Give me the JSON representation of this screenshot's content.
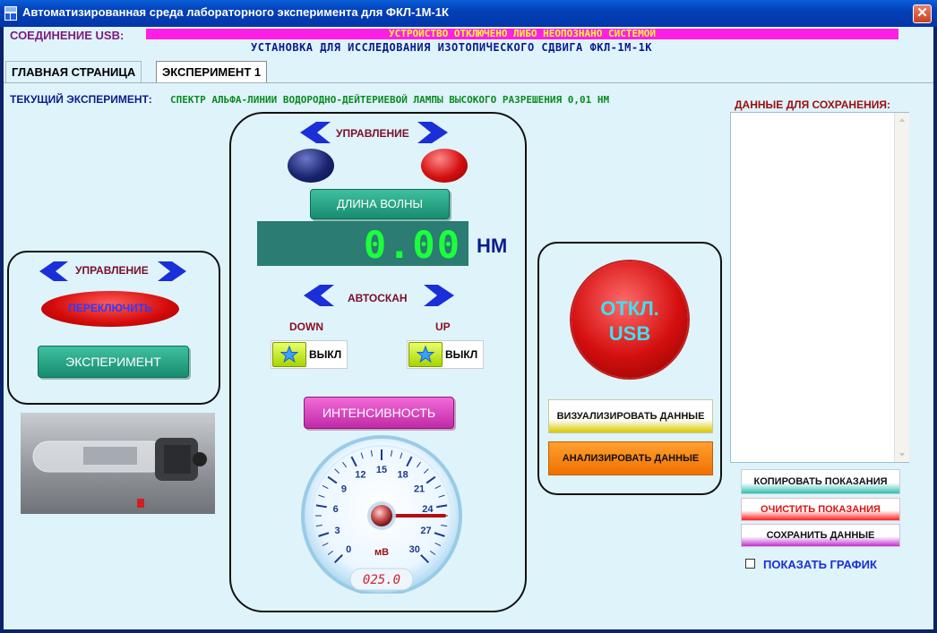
{
  "window": {
    "title": "Автоматизированная среда лабораторного эксперимента для ФКЛ-1М-1К",
    "close_glyph": "✕"
  },
  "status": {
    "usb_label": "СОЕДИНЕНИЕ USB:",
    "usb_message": "УСТРОЙСТВО ОТКЛЮЧЕНО ЛИБО НЕОПОЗНАНО СИСТЕМОЙ",
    "setup_title": "УСТАНОВКА ДЛЯ ИССЛЕДОВАНИЯ ИЗОТОПИЧЕСКОГО СДВИГА ФКЛ-1М-1К"
  },
  "tabs": [
    {
      "label": "ГЛАВНАЯ СТРАНИЦА",
      "active": false
    },
    {
      "label": "ЭКСПЕРИМЕНТ 1",
      "active": true
    }
  ],
  "experiment": {
    "label": "ТЕКУЩИЙ ЭКСПЕРИМЕНТ:",
    "value": "СПЕКТР АЛЬФА-ЛИНИИ ВОДОРОДНО-ДЕЙТЕРИЕВОЙ ЛАМПЫ ВЫСОКОГО РАЗРЕШЕНИЯ 0,01 НМ"
  },
  "left_panel": {
    "control_label": "УПРАВЛЕНИЕ",
    "switch_label": "ПЕРЕКЛЮЧИТЬ",
    "experiment_button": "ЭКСПЕРИМЕНТ"
  },
  "center_panel": {
    "control_label": "УПРАВЛЕНИЕ",
    "wavelength_button": "ДЛИНА ВОЛНЫ",
    "wavelength_value": "0.00",
    "wavelength_unit": "НМ",
    "autoscan_label": "АВТОСКАН",
    "down_label": "DOWN",
    "up_label": "UP",
    "down_state": "ВЫКЛ",
    "up_state": "ВЫКЛ",
    "intensity_button": "ИНТЕНСИВНОСТЬ",
    "gauge": {
      "ticks": [
        "0",
        "3",
        "6",
        "9",
        "12",
        "15",
        "18",
        "21",
        "24",
        "27",
        "30"
      ],
      "unit": "мВ",
      "readout": "025.0",
      "value": 25.0,
      "min": 0,
      "max": 30
    }
  },
  "right_panel": {
    "usb_button_line1": "ОТКЛ.",
    "usb_button_line2": "USB",
    "visualize_button": "ВИЗУАЛИЗИРОВАТЬ ДАННЫЕ",
    "analyze_button": "АНАЛИЗИРОВАТЬ ДАННЫЕ"
  },
  "save_panel": {
    "label": "ДАННЫЕ ДЛЯ СОХРАНЕНИЯ:",
    "copy_button": "КОПИРОВАТЬ ПОКАЗАНИЯ",
    "clear_button": "ОЧИСТИТЬ ПОКАЗАНИЯ",
    "save_button": "СОХРАНИТЬ ДАННЫЕ",
    "show_graph_label": "ПОКАЗАТЬ ГРАФИК",
    "show_graph_checked": false
  },
  "colors": {
    "background": "#dff3fb",
    "accent_blue": "#0a1d8a",
    "usb_bar": "#ff1ee6",
    "lcd_digits": "#1cff3c"
  }
}
